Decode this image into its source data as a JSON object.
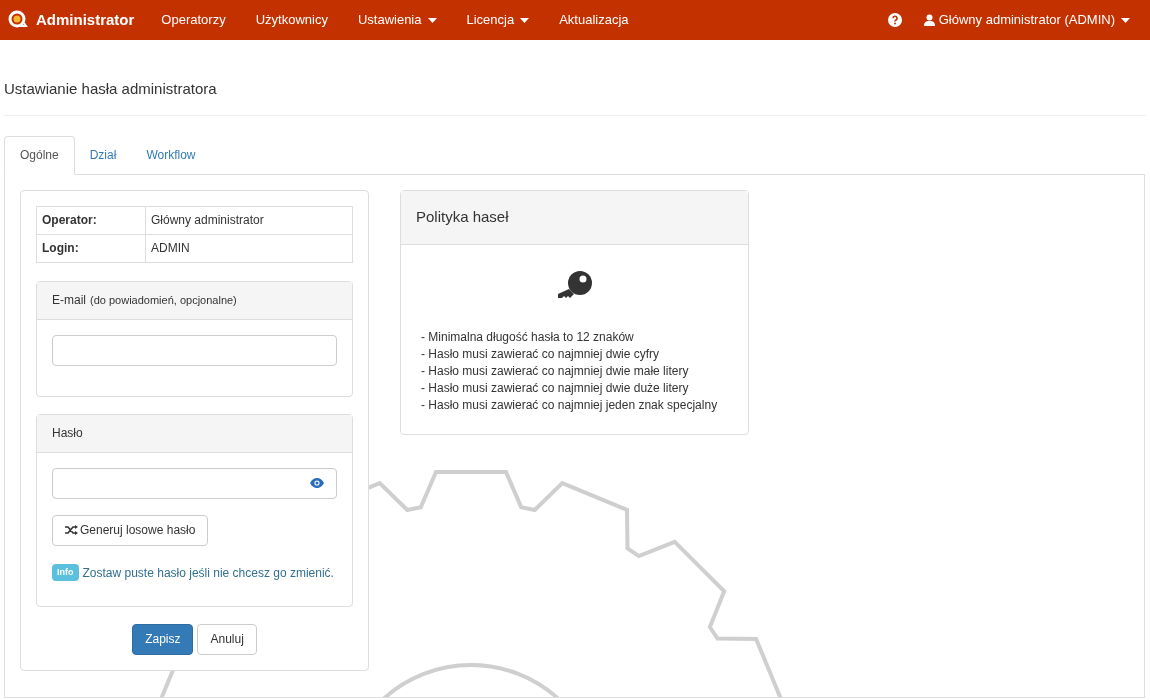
{
  "navbar": {
    "brand": "Administrator",
    "items": [
      {
        "label": "Operatorzy",
        "dropdown": false
      },
      {
        "label": "Użytkownicy",
        "dropdown": false
      },
      {
        "label": "Ustawienia",
        "dropdown": true
      },
      {
        "label": "Licencja",
        "dropdown": true
      },
      {
        "label": "Aktualizacja",
        "dropdown": false
      }
    ],
    "user": {
      "label": "Główny administrator (ADMIN)",
      "dropdown": true
    }
  },
  "page_title": "Ustawianie hasła administratora",
  "tabs": [
    {
      "label": "Ogólne",
      "selected": true
    },
    {
      "label": "Dział",
      "selected": false
    },
    {
      "label": "Workflow",
      "selected": false
    }
  ],
  "info_table": [
    {
      "label": "Operator:",
      "value": "Główny administrator"
    },
    {
      "label": "Login:",
      "value": "ADMIN"
    }
  ],
  "email": {
    "heading": "E-mail",
    "hint": "(do powiadomień, opcjonalne)"
  },
  "password": {
    "heading": "Hasło",
    "generate_button": "Generuj losowe hasło",
    "badge": "Info",
    "note": "Zostaw puste hasło jeśli nie chcesz go zmienić."
  },
  "buttons": [
    {
      "label": "Zapisz",
      "kind": "primary"
    },
    {
      "label": "Anuluj",
      "kind": "default"
    }
  ],
  "policy": {
    "title": "Polityka haseł",
    "rules": [
      "- Minimalna długość hasła to 12 znaków",
      "- Hasło musi zawierać co najmniej dwie cyfry",
      "- Hasło musi zawierać co najmniej dwie małe litery",
      "- Hasło musi zawierać co najmniej dwie duże litery",
      "- Hasło musi zawierać co najmniej jeden znak specjalny"
    ]
  }
}
